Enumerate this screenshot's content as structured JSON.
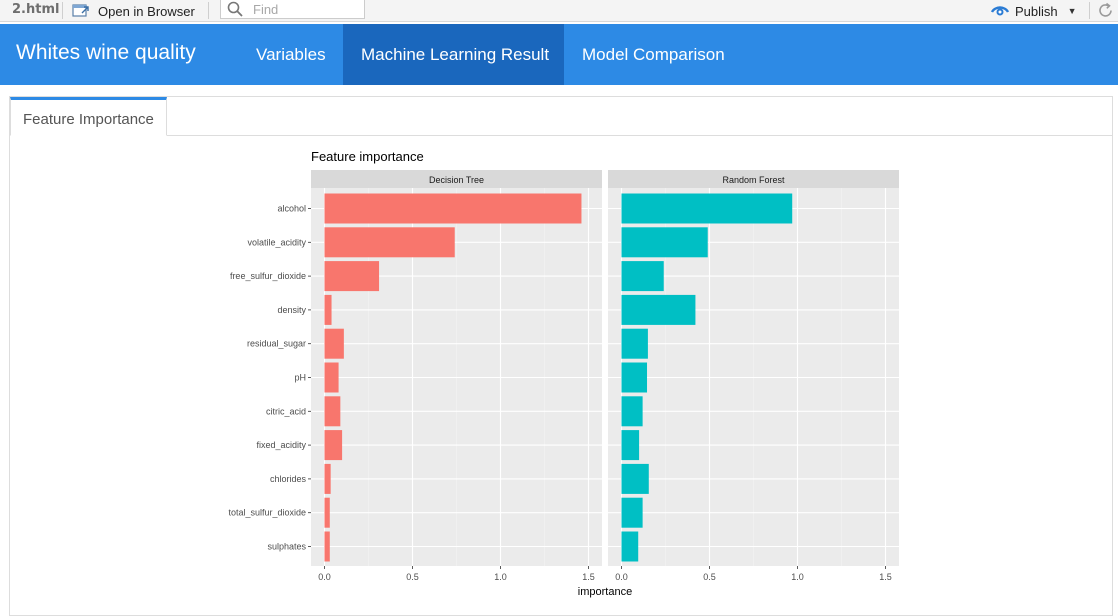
{
  "toolbar": {
    "file_name": "2.html",
    "open_in_browser": "Open in Browser",
    "find_placeholder": "Find",
    "publish": "Publish"
  },
  "navbar": {
    "brand": "Whites wine quality",
    "tabs": [
      {
        "label": "Variables"
      },
      {
        "label": "Machine Learning Result"
      },
      {
        "label": "Model Comparison"
      }
    ],
    "active_tab": "Machine Learning Result"
  },
  "subtab": {
    "label": "Feature Importance"
  },
  "colors": {
    "navbar": "#2d8ae5",
    "navbar_active": "#1a67bd",
    "series_1": "#f8766d",
    "series_2": "#00bfc4",
    "panel_bg": "#ebebeb",
    "strip_bg": "#d9d9d9"
  },
  "chart_data": {
    "type": "bar",
    "orientation": "horizontal",
    "title": "Feature importance",
    "xlabel": "importance",
    "ylabel": "",
    "xlim": [
      0,
      1.5
    ],
    "xticks": [
      "0.0",
      "0.5",
      "1.0",
      "1.5"
    ],
    "grid": true,
    "legend": "none",
    "categories": [
      "alcohol",
      "volatile_acidity",
      "free_sulfur_dioxide",
      "density",
      "residual_sugar",
      "pH",
      "citric_acid",
      "fixed_acidity",
      "chlorides",
      "total_sulfur_dioxide",
      "sulphates"
    ],
    "series": [
      {
        "name": "Decision Tree",
        "values": [
          1.46,
          0.74,
          0.31,
          0.04,
          0.11,
          0.08,
          0.09,
          0.1,
          0.035,
          0.03,
          0.03
        ]
      },
      {
        "name": "Random Forest",
        "values": [
          0.97,
          0.49,
          0.24,
          0.42,
          0.15,
          0.145,
          0.12,
          0.1,
          0.155,
          0.12,
          0.095
        ]
      }
    ]
  }
}
